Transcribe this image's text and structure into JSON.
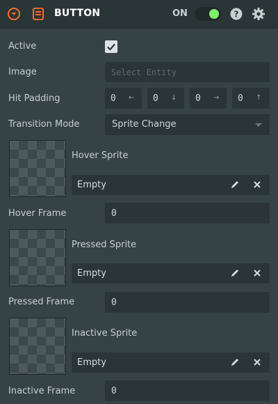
{
  "header": {
    "title": "BUTTON",
    "toggle_label": "ON",
    "toggle_state": true,
    "accent_color": "#ff6a28",
    "toggle_color": "#7ff06a",
    "icons": [
      "collapse-icon",
      "button-component-icon",
      "help-icon",
      "gear-icon"
    ]
  },
  "fields": {
    "active": {
      "label": "Active",
      "checked": true
    },
    "image": {
      "label": "Image",
      "placeholder": "Select Entity"
    },
    "hit_padding": {
      "label": "Hit Padding",
      "values": [
        "0",
        "0",
        "0",
        "0"
      ],
      "arrows": [
        "←",
        "↓",
        "→",
        "↑"
      ]
    },
    "transition_mode": {
      "label": "Transition Mode",
      "value": "Sprite Change"
    },
    "hover_sprite": {
      "label": "Hover Sprite",
      "value": "Empty"
    },
    "hover_frame": {
      "label": "Hover Frame",
      "value": "0"
    },
    "pressed_sprite": {
      "label": "Pressed Sprite",
      "value": "Empty"
    },
    "pressed_frame": {
      "label": "Pressed Frame",
      "value": "0"
    },
    "inactive_sprite": {
      "label": "Inactive Sprite",
      "value": "Empty"
    },
    "inactive_frame": {
      "label": "Inactive Frame",
      "value": "0"
    }
  }
}
